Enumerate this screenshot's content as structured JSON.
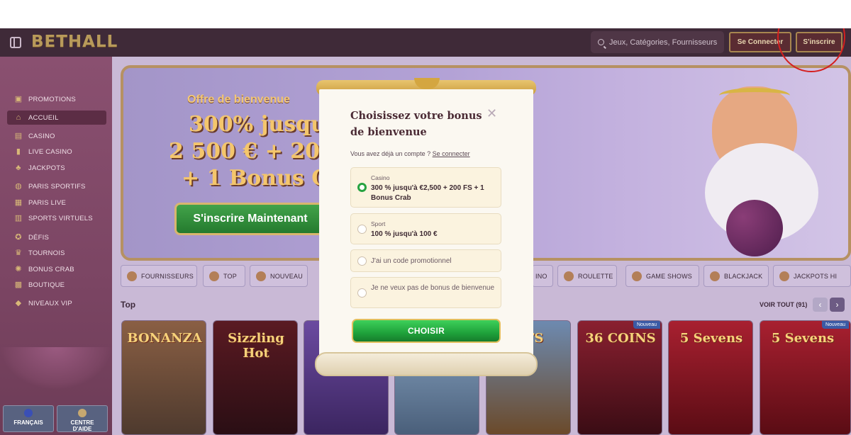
{
  "header": {
    "logo": "BETHALL",
    "search_placeholder": "Jeux, Catégories, Fournisseurs",
    "login_label": "Se Connecter",
    "signup_label": "S'inscrire"
  },
  "sidebar": {
    "items": [
      {
        "label": "PROMOTIONS",
        "icon": "gift-icon"
      },
      {
        "label": "ACCUEIL",
        "icon": "home-icon"
      },
      {
        "label": "CASINO",
        "icon": "casino-icon"
      },
      {
        "label": "LIVE CASINO",
        "icon": "live-casino-icon"
      },
      {
        "label": "JACKPOTS",
        "icon": "clover-icon"
      },
      {
        "label": "PARIS SPORTIFS",
        "icon": "football-icon"
      },
      {
        "label": "PARIS LIVE",
        "icon": "live-bet-icon"
      },
      {
        "label": "SPORTS VIRTUELS",
        "icon": "virtual-sports-icon"
      },
      {
        "label": "DÉFIS",
        "icon": "challenge-icon"
      },
      {
        "label": "TOURNOIS",
        "icon": "trophy-icon"
      },
      {
        "label": "BONUS CRAB",
        "icon": "crab-icon"
      },
      {
        "label": "BOUTIQUE",
        "icon": "shop-icon"
      },
      {
        "label": "NIVEAUX VIP",
        "icon": "diamond-icon"
      }
    ],
    "language_label": "FRANÇAIS",
    "help_label_1": "CENTRE",
    "help_label_2": "D'AIDE"
  },
  "banner": {
    "welcome": "Offre de bienvenue",
    "line1": "300% jusqu'à",
    "line2": "2 500 € + 200 F",
    "line3": "+ 1 Bonus Crab",
    "cta": "S'inscrire Maintenant"
  },
  "categories": [
    {
      "label": "FOURNISSEURS"
    },
    {
      "label": "TOP"
    },
    {
      "label": "NOUVEAU"
    },
    {
      "label": "INO"
    },
    {
      "label": "ROULETTE"
    },
    {
      "label": "GAME SHOWS"
    },
    {
      "label": "BLACKJACK"
    },
    {
      "label": "JACKPOTS HI"
    }
  ],
  "section": {
    "title": "Top",
    "see_all": "VOIR TOUT (91)",
    "prev": "‹",
    "next": "›"
  },
  "games": [
    {
      "name": "BONANZA",
      "color": "#6b4a3a"
    },
    {
      "name": "Sizzling Hot",
      "color": "#3a1a1f"
    },
    {
      "name": "",
      "color": "#5b3d8a"
    },
    {
      "name": "",
      "color": "#6a8aa8"
    },
    {
      "name": "RFS",
      "color": "#8a6a3a"
    },
    {
      "name": "36 COINS",
      "color": "#6b1f2a",
      "badge": "Nouveau"
    },
    {
      "name": "5 Sevens",
      "color": "#7a1a22"
    },
    {
      "name": "5 Sevens",
      "color": "#7a1a22",
      "badge": "Nouveau"
    }
  ],
  "modal": {
    "title": "Choisissez votre bonus de bienvenue",
    "close": "✕",
    "account_text": "Vous avez déjà un compte ?",
    "account_link": "Se connecter",
    "options": [
      {
        "type": "Casino",
        "desc": "300 % jusqu'à €2,500 + 200 FS + 1 Bonus Crab",
        "selected": true
      },
      {
        "type": "Sport",
        "desc": "100 % jusqu'à 100 €",
        "selected": false
      },
      {
        "type": "",
        "desc": "J'ai un code promotionnel",
        "selected": false
      },
      {
        "type": "",
        "desc": "Je ne veux pas de bonus de bienvenue",
        "selected": false
      }
    ],
    "choose_label": "CHOISIR"
  },
  "colors": {
    "header_bg": "#3f2a38",
    "sidebar_bg": "#7b4563",
    "accent_gold": "#b89a5a",
    "choose_green": "#1fa23b",
    "annotation_red": "#d51f1f"
  }
}
